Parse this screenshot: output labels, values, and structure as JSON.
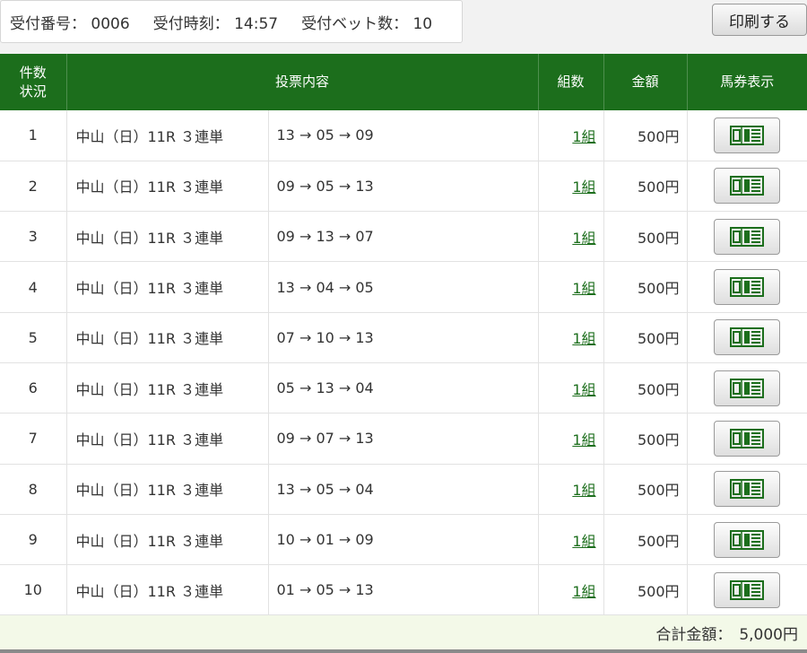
{
  "receipt": {
    "number_label": "受付番号：",
    "number": "0006",
    "time_label": "受付時刻：",
    "time": "14:57",
    "bet_count_label": "受付ベット数：",
    "bet_count": "10"
  },
  "print_button": {
    "label": "印刷する"
  },
  "table": {
    "headers": {
      "count_line1": "件数",
      "count_line2": "状況",
      "content": "投票内容",
      "kumi": "組数",
      "amount": "金額",
      "ticket": "馬券表示"
    },
    "rows": [
      {
        "no": "1",
        "race": "中山（日）11R ３連単",
        "combo": "13 → 05 → 09",
        "kumi": "1組",
        "amount": "500円"
      },
      {
        "no": "2",
        "race": "中山（日）11R ３連単",
        "combo": "09 → 05 → 13",
        "kumi": "1組",
        "amount": "500円"
      },
      {
        "no": "3",
        "race": "中山（日）11R ３連単",
        "combo": "09 → 13 → 07",
        "kumi": "1組",
        "amount": "500円"
      },
      {
        "no": "4",
        "race": "中山（日）11R ３連単",
        "combo": "13 → 04 → 05",
        "kumi": "1組",
        "amount": "500円"
      },
      {
        "no": "5",
        "race": "中山（日）11R ３連単",
        "combo": "07 → 10 → 13",
        "kumi": "1組",
        "amount": "500円"
      },
      {
        "no": "6",
        "race": "中山（日）11R ３連単",
        "combo": "05 → 13 → 04",
        "kumi": "1組",
        "amount": "500円"
      },
      {
        "no": "7",
        "race": "中山（日）11R ３連単",
        "combo": "09 → 07 → 13",
        "kumi": "1組",
        "amount": "500円"
      },
      {
        "no": "8",
        "race": "中山（日）11R ３連単",
        "combo": "13 → 05 → 04",
        "kumi": "1組",
        "amount": "500円"
      },
      {
        "no": "9",
        "race": "中山（日）11R ３連単",
        "combo": "10 → 01 → 09",
        "kumi": "1組",
        "amount": "500円"
      },
      {
        "no": "10",
        "race": "中山（日）11R ３連単",
        "combo": "01 → 05 → 13",
        "kumi": "1組",
        "amount": "500円"
      }
    ],
    "ticket_icon": "ticket-icon"
  },
  "total": {
    "label": "合計金額：",
    "value": "5,000円"
  },
  "colors": {
    "header_green": "#1c6e1c",
    "link_green": "#1c6e1c",
    "footer_bg": "#f3f9e8",
    "page_bg": "#f2f2f2"
  }
}
